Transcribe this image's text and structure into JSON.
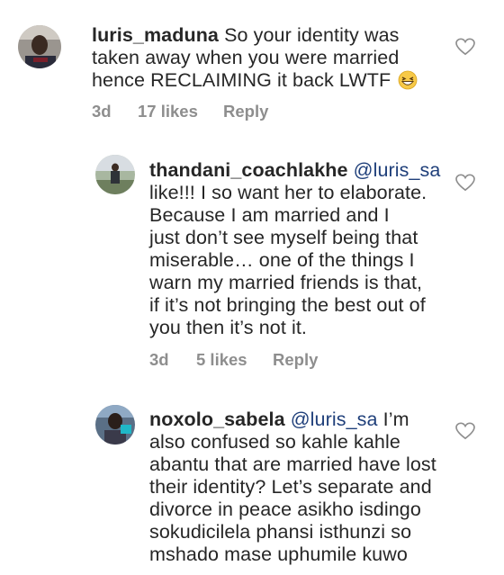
{
  "comments": [
    {
      "username": "luris_maduna",
      "mention": "",
      "lines": [
        "So your identity was",
        "taken away when you were married",
        "hence RECLAIMING it back LWTF"
      ],
      "emoji": "grinning-squinting-face",
      "time": "3d",
      "likes": "17 likes",
      "reply": "Reply"
    },
    {
      "username": "thandani_coachlakhe",
      "mention": "@luris_sa",
      "lines": [
        "like!!! I so want her to elaborate.",
        "Because I am married and I",
        "just don’t see myself being that",
        "miserable… one of the things I",
        "warn my married friends is that,",
        "if it’s not bringing the best out of",
        "you then it’s not it."
      ],
      "time": "3d",
      "likes": "5 likes",
      "reply": "Reply"
    },
    {
      "username": "noxolo_sabela",
      "mention": "@luris_sa",
      "first_tail": "I’m",
      "lines": [
        "also confused so kahle kahle",
        "abantu that are married have lost",
        "their identity? Let’s separate and",
        "divorce in peace asikho isdingo",
        "sokudicilela phansi isthunzi so",
        "mshado mase uphumile kuwo"
      ]
    }
  ],
  "colors": {
    "text": "#262626",
    "meta": "#8e8e8e",
    "mention": "#1f3f7a"
  }
}
